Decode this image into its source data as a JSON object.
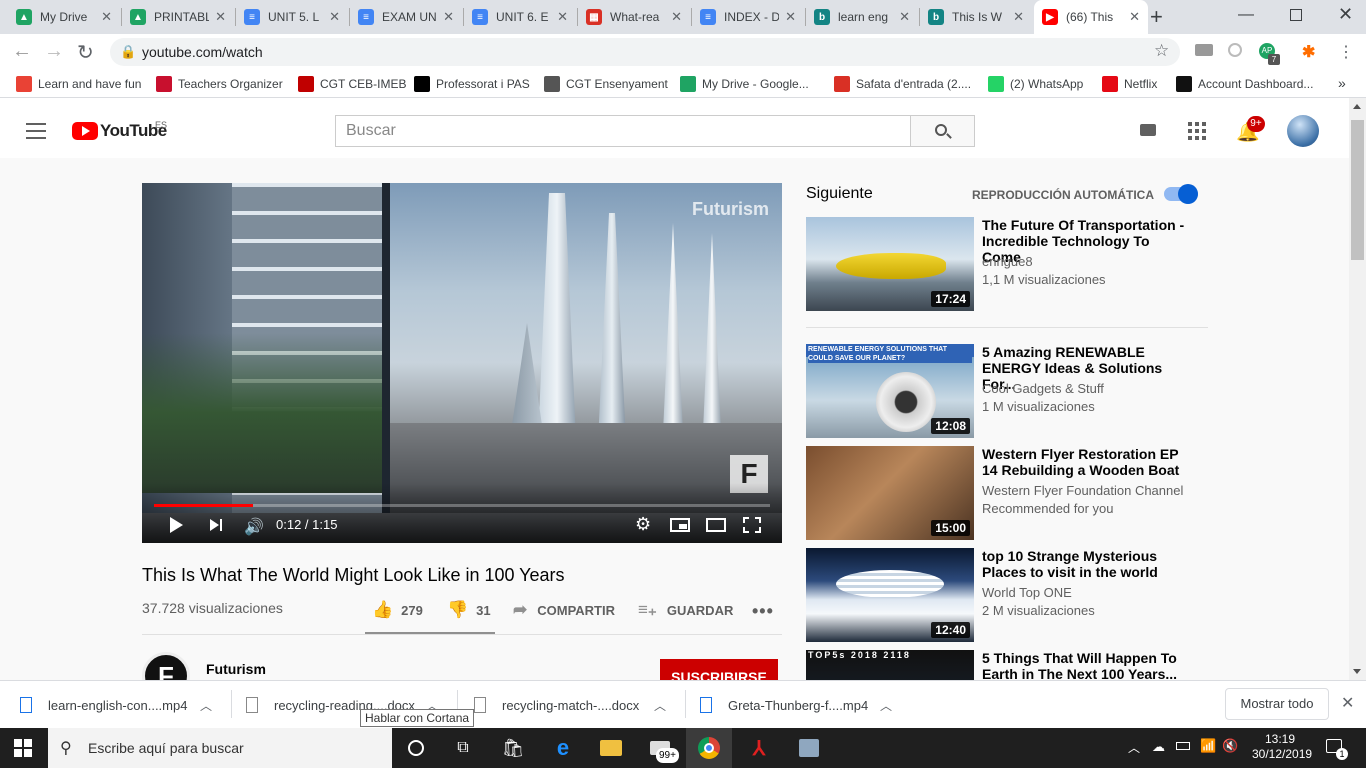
{
  "browser": {
    "tabs": [
      {
        "label": "My Drive",
        "color": "#1fa463",
        "glyph": "▲"
      },
      {
        "label": "PRINTABL",
        "color": "#1fa463",
        "glyph": "▲"
      },
      {
        "label": "UNIT 5. L",
        "color": "#4285f4",
        "glyph": "≡"
      },
      {
        "label": "EXAM UN",
        "color": "#4285f4",
        "glyph": "≡"
      },
      {
        "label": "UNIT 6. E",
        "color": "#4285f4",
        "glyph": "≡"
      },
      {
        "label": "What-rea",
        "color": "#d93025",
        "glyph": "▦"
      },
      {
        "label": "INDEX - D",
        "color": "#4285f4",
        "glyph": "≡"
      },
      {
        "label": "learn eng",
        "color": "#138484",
        "glyph": "b"
      },
      {
        "label": "This Is W",
        "color": "#138484",
        "glyph": "b"
      },
      {
        "label": "(66) This",
        "color": "#ff0000",
        "glyph": "▶"
      }
    ],
    "url": "youtube.com/watch",
    "bookmarks": [
      {
        "label": "Learn and have fun",
        "color": "#e94235"
      },
      {
        "label": "Teachers Organizer",
        "color": "#c8102e"
      },
      {
        "label": "CGT CEB-IMEB",
        "color": "#c00000"
      },
      {
        "label": "Professorat i PAS",
        "color": "#000000"
      },
      {
        "label": "CGT Ensenyament",
        "color": "#555555"
      },
      {
        "label": "My Drive - Google...",
        "color": "#1fa463"
      },
      {
        "label": "Safata d'entrada (2....",
        "color": "#d93025"
      },
      {
        "label": "(2) WhatsApp",
        "color": "#25d366"
      },
      {
        "label": "Netflix",
        "color": "#e50914"
      },
      {
        "label": "Account Dashboard...",
        "color": "#111111"
      }
    ],
    "profile_badge": "7",
    "more": "»"
  },
  "youtube": {
    "logo": "YouTube",
    "region": "ES",
    "search_placeholder": "Buscar",
    "notifications": "9+",
    "player": {
      "watermark": "Futurism",
      "time": "0:12 / 1:15",
      "progress": 0.16
    },
    "video_title": "This Is What The World Might Look Like in 100 Years",
    "views": "37.728 visualizaciones",
    "likes": "279",
    "dislikes": "31",
    "share": "COMPARTIR",
    "save": "GUARDAR",
    "channel": "Futurism",
    "subscribe": "SUSCRIBIRSE",
    "up_next": "Siguiente",
    "autoplay": "REPRODUCCIÓN AUTOMÁTICA",
    "recommendations": [
      {
        "title": "The Future Of Transportation - Incredible Technology To Come",
        "channel": "enrigue8",
        "views": "1,1 M visualizaciones",
        "duration": "17:24"
      },
      {
        "title": "5 Amazing RENEWABLE ENERGY Ideas & Solutions For...",
        "channel": "Cool Gadgets & Stuff",
        "views": "1 M visualizaciones",
        "duration": "12:08",
        "thumb_text": "RENEWABLE ENERGY SOLUTIONS THAT COULD SAVE OUR PLANET?"
      },
      {
        "title": "Western Flyer Restoration EP 14 Rebuilding a Wooden Boat",
        "channel": "Western Flyer Foundation Channel",
        "views": "Recommended for you",
        "duration": "15:00"
      },
      {
        "title": "top 10 Strange Mysterious Places to visit in the world",
        "channel": "World Top ONE",
        "views": "2 M visualizaciones",
        "duration": "12:40"
      },
      {
        "title": "5 Things That Will Happen To Earth in The Next 100 Years...",
        "channel": "",
        "views": "",
        "duration": "",
        "thumb_text": "TOP5s 2018 2118"
      }
    ]
  },
  "downloads": {
    "items": [
      "learn-english-con....mp4",
      "recycling-reading....docx",
      "recycling-match-....docx",
      "Greta-Thunberg-f....mp4"
    ],
    "show_all": "Mostrar todo",
    "tooltip": "Hablar con Cortana"
  },
  "taskbar": {
    "search_placeholder": "Escribe aquí para buscar",
    "badge": "99+",
    "time": "13:19",
    "date": "30/12/2019",
    "notif_count": "1"
  }
}
